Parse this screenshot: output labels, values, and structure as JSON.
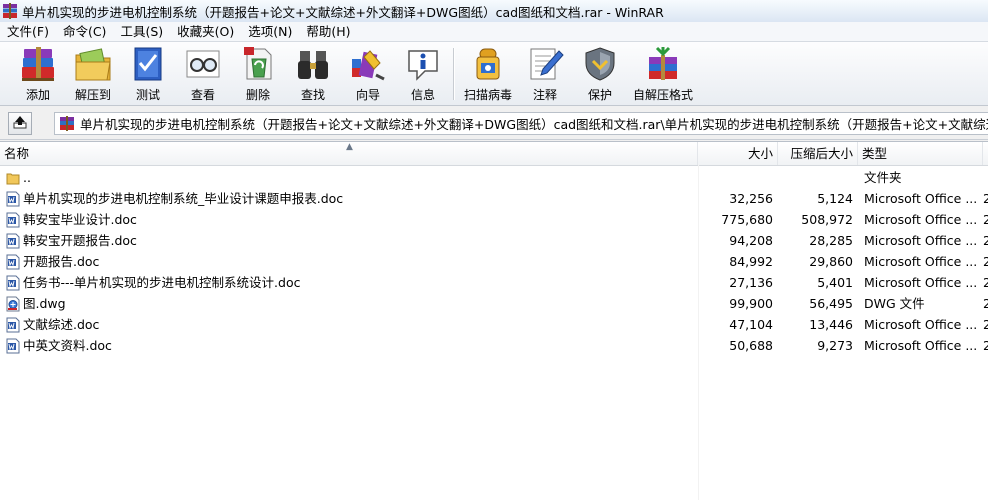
{
  "window": {
    "title": "单片机实现的步进电机控制系统（开题报告+论文+文献综述+外文翻译+DWG图纸）cad图纸和文档.rar - WinRAR"
  },
  "menu": [
    "文件(F)",
    "命令(C)",
    "工具(S)",
    "收藏夹(O)",
    "选项(N)",
    "帮助(H)"
  ],
  "toolbar": [
    {
      "label": "添加",
      "icon": "books-add-icon"
    },
    {
      "label": "解压到",
      "icon": "folder-extract-icon"
    },
    {
      "label": "测试",
      "icon": "book-check-icon"
    },
    {
      "label": "查看",
      "icon": "glasses-view-icon"
    },
    {
      "label": "删除",
      "icon": "recycle-delete-icon"
    },
    {
      "label": "查找",
      "icon": "binoculars-find-icon"
    },
    {
      "label": "向导",
      "icon": "magic-wizard-icon"
    },
    {
      "label": "信息",
      "icon": "info-icon"
    },
    {
      "label": "扫描病毒",
      "icon": "virus-scan-icon"
    },
    {
      "label": "注释",
      "icon": "comment-pen-icon"
    },
    {
      "label": "保护",
      "icon": "shield-protect-icon"
    },
    {
      "label": "自解压格式",
      "icon": "sfx-archive-icon"
    }
  ],
  "address": {
    "path": "单片机实现的步进电机控制系统（开题报告+论文+文献综述+外文翻译+DWG图纸）cad图纸和文档.rar\\单片机实现的步进电机控制系统（开题报告+论文+文献综述+外文翻译"
  },
  "columns": {
    "name": "名称",
    "size": "大小",
    "packed": "压缩后大小",
    "type": "类型"
  },
  "files": [
    {
      "name": "..",
      "size": "",
      "packed": "",
      "type": "文件夹",
      "icon": "folder-icon"
    },
    {
      "name": "单片机实现的步进电机控制系统_毕业设计课题申报表.doc",
      "size": "32,256",
      "packed": "5,124",
      "type": "Microsoft Office ...",
      "extra": "2",
      "icon": "word-doc-icon"
    },
    {
      "name": "韩安宝毕业设计.doc",
      "size": "775,680",
      "packed": "508,972",
      "type": "Microsoft Office ...",
      "extra": "2",
      "icon": "word-doc-icon"
    },
    {
      "name": "韩安宝开题报告.doc",
      "size": "94,208",
      "packed": "28,285",
      "type": "Microsoft Office ...",
      "extra": "2",
      "icon": "word-doc-icon"
    },
    {
      "name": "开题报告.doc",
      "size": "84,992",
      "packed": "29,860",
      "type": "Microsoft Office ...",
      "extra": "2",
      "icon": "word-doc-icon"
    },
    {
      "name": "任务书---单片机实现的步进电机控制系统设计.doc",
      "size": "27,136",
      "packed": "5,401",
      "type": "Microsoft Office ...",
      "extra": "2",
      "icon": "word-doc-icon"
    },
    {
      "name": "图.dwg",
      "size": "99,900",
      "packed": "56,495",
      "type": "DWG 文件",
      "extra": "2",
      "icon": "dwg-file-icon"
    },
    {
      "name": "文献综述.doc",
      "size": "47,104",
      "packed": "13,446",
      "type": "Microsoft Office ...",
      "extra": "2",
      "icon": "word-doc-icon"
    },
    {
      "name": "中英文资料.doc",
      "size": "50,688",
      "packed": "9,273",
      "type": "Microsoft Office ...",
      "extra": "2",
      "icon": "word-doc-icon"
    }
  ]
}
